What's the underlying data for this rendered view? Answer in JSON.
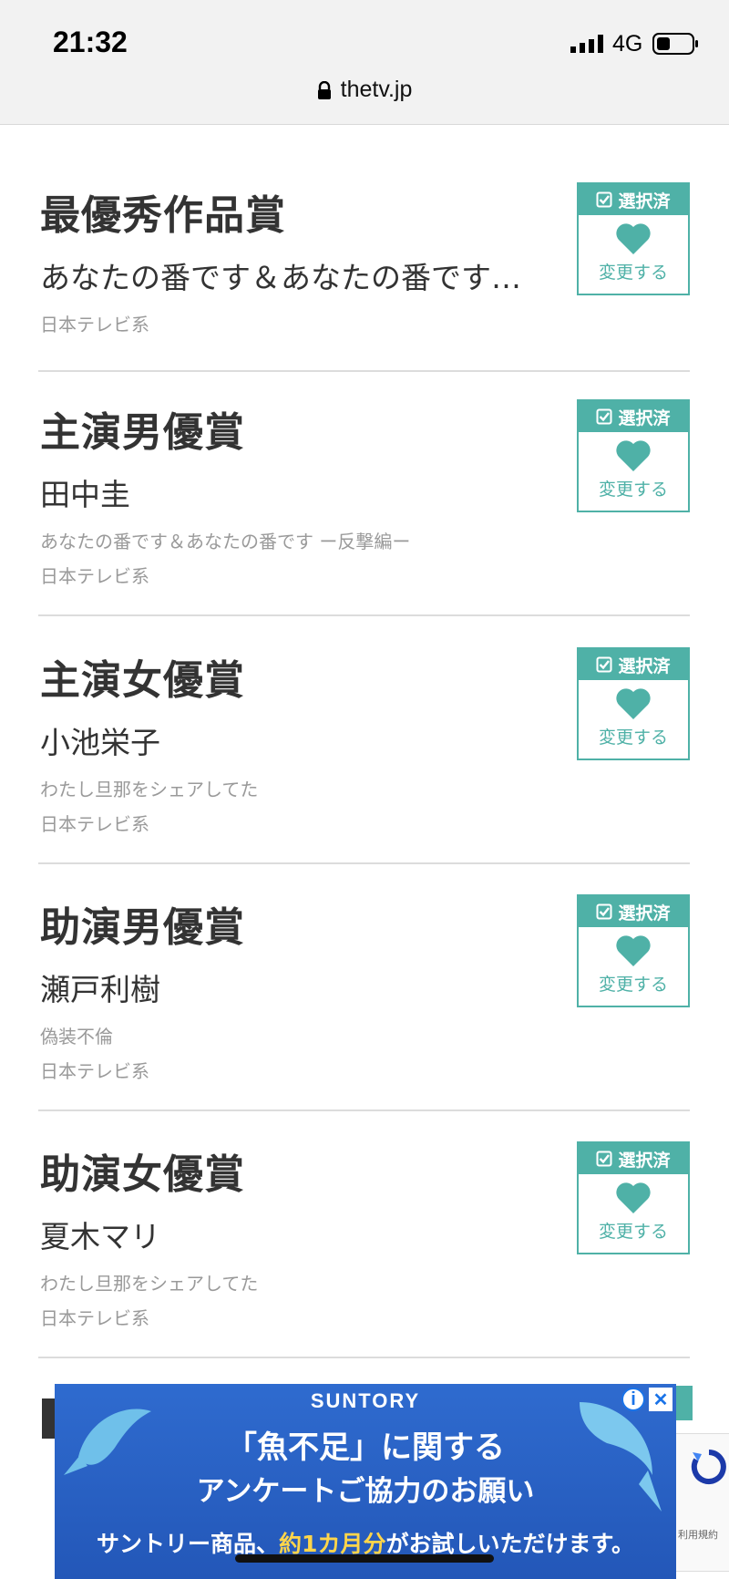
{
  "status_bar": {
    "time": "21:32",
    "network": "4G"
  },
  "browser": {
    "url": "thetv.jp"
  },
  "awards": [
    {
      "category": "最優秀作品賞",
      "nominee": "あなたの番です＆あなたの番です…",
      "work": "",
      "network": "日本テレビ系",
      "badge": "選択済",
      "change": "変更する"
    },
    {
      "category": "主演男優賞",
      "nominee": "田中圭",
      "work": "あなたの番です＆あなたの番です ー反撃編ー",
      "network": "日本テレビ系",
      "badge": "選択済",
      "change": "変更する"
    },
    {
      "category": "主演女優賞",
      "nominee": "小池栄子",
      "work": "わたし旦那をシェアしてた",
      "network": "日本テレビ系",
      "badge": "選択済",
      "change": "変更する"
    },
    {
      "category": "助演男優賞",
      "nominee": "瀬戸利樹",
      "work": "偽装不倫",
      "network": "日本テレビ系",
      "badge": "選択済",
      "change": "変更する"
    },
    {
      "category": "助演女優賞",
      "nominee": "夏木マリ",
      "work": "わたし旦那をシェアしてた",
      "network": "日本テレビ系",
      "badge": "選択済",
      "change": "変更する"
    }
  ],
  "ad": {
    "brand": "SUNTORY",
    "headline1": "「魚不足」に関する",
    "headline2": "アンケートご協力のお願い",
    "line_pre": "サントリー商品、",
    "line_highlight": "約1カ月分",
    "line_post": "がお試しいただけます。",
    "info_icon": "i",
    "close_icon": "✕"
  },
  "recaptcha": {
    "text": "利用規約"
  },
  "colors": {
    "accent": "#4fb1a7",
    "ad_bg": "#2357b8"
  }
}
